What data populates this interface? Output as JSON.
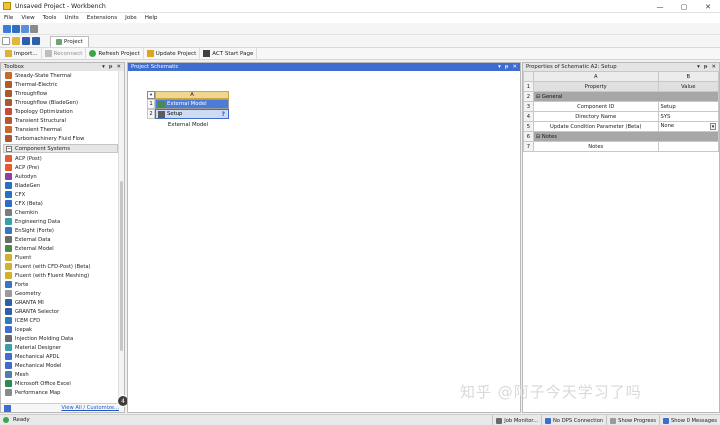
{
  "window": {
    "title": "Unsaved Project - Workbench",
    "controls": [
      "—",
      "▢",
      "✕"
    ]
  },
  "menu": [
    "File",
    "View",
    "Tools",
    "Units",
    "Extensions",
    "Jobs",
    "Help"
  ],
  "project_tab": {
    "label": "Project"
  },
  "toolbar": {
    "import": "Import...",
    "reconnect": "Reconnect",
    "refresh": "Refresh Project",
    "update": "Update Project",
    "act_start": "ACT Start Page"
  },
  "toolbox": {
    "title": "Toolbox",
    "header_buttons": [
      "▾",
      "ᵽ",
      "✕"
    ],
    "analysis_items": [
      {
        "label": "Steady-State Thermal",
        "color": "#c66a2b"
      },
      {
        "label": "Thermal-Electric",
        "color": "#b45a2a"
      },
      {
        "label": "Throughflow",
        "color": "#a65a2e"
      },
      {
        "label": "Throughflow (BladeGen)",
        "color": "#a65a2e"
      },
      {
        "label": "Topology Optimization",
        "color": "#c94a36"
      },
      {
        "label": "Transient Structural",
        "color": "#b35b2e"
      },
      {
        "label": "Transient Thermal",
        "color": "#c96a2a"
      },
      {
        "label": "Turbomachinery Fluid Flow",
        "color": "#a55a2f"
      }
    ],
    "group_label": "Component Systems",
    "component_items": [
      {
        "label": "ACP (Post)",
        "color": "#e8592e"
      },
      {
        "label": "ACP (Pre)",
        "color": "#e8592e"
      },
      {
        "label": "Autodyn",
        "color": "#8f3fa1"
      },
      {
        "label": "BladeGen",
        "color": "#2f6ebd"
      },
      {
        "label": "CFX",
        "color": "#2d6fc7"
      },
      {
        "label": "CFX (Beta)",
        "color": "#2d6fc7"
      },
      {
        "label": "Chemkin",
        "color": "#7c7c7c"
      },
      {
        "label": "Engineering Data",
        "color": "#3aa0a8"
      },
      {
        "label": "EnSight (Forte)",
        "color": "#3c74c4"
      },
      {
        "label": "External Data",
        "color": "#6b6b6b"
      },
      {
        "label": "External Model",
        "color": "#4c8a4c"
      },
      {
        "label": "Fluent",
        "color": "#d4b12b"
      },
      {
        "label": "Fluent (with CFD-Post) (Beta)",
        "color": "#d4b12b"
      },
      {
        "label": "Fluent (with Fluent Meshing)",
        "color": "#d4b12b"
      },
      {
        "label": "Forte",
        "color": "#3c74c4"
      },
      {
        "label": "Geometry",
        "color": "#9b9b9b"
      },
      {
        "label": "GRANTA MI",
        "color": "#2f5fa8"
      },
      {
        "label": "GRANTA Selector",
        "color": "#2f5fa8"
      },
      {
        "label": "ICEM CFD",
        "color": "#2e7cc0"
      },
      {
        "label": "Icepak",
        "color": "#3f6ccf"
      },
      {
        "label": "Injection Molding Data",
        "color": "#6a6a6a"
      },
      {
        "label": "Material Designer",
        "color": "#3aa0a8"
      },
      {
        "label": "Mechanical APDL",
        "color": "#3f6ccf"
      },
      {
        "label": "Mechanical Model",
        "color": "#3f6ccf"
      },
      {
        "label": "Mesh",
        "color": "#4f7ea8"
      },
      {
        "label": "Microsoft Office Excel",
        "color": "#2e8b4f"
      },
      {
        "label": "Performance Map",
        "color": "#8a8a8a"
      }
    ],
    "footer_link": "View All / Customize...",
    "badge": "4"
  },
  "schematic": {
    "title": "Project Schematic",
    "system": {
      "column": "A",
      "rows": [
        {
          "num": "1",
          "label": "External Model",
          "icon_color": "#4c8a4c"
        },
        {
          "num": "2",
          "label": "Setup",
          "icon_color": "#5c5c5c",
          "status": "?"
        }
      ],
      "caption": "External Model"
    }
  },
  "properties": {
    "title": "Properties of Schematic A2: Setup",
    "columns": [
      "A",
      "B"
    ],
    "header": {
      "num": "1",
      "a": "Property",
      "b": "Value"
    },
    "rows": [
      {
        "num": "2",
        "group": true,
        "a": "General"
      },
      {
        "num": "3",
        "a": "Component ID",
        "b": "Setup"
      },
      {
        "num": "4",
        "a": "Directory Name",
        "b": "SYS"
      },
      {
        "num": "5",
        "a": "Update Condition Parameter (Beta)",
        "b": "None"
      },
      {
        "num": "6",
        "group": true,
        "a": "Notes"
      },
      {
        "num": "7",
        "a": "Notes",
        "b": ""
      }
    ]
  },
  "status": {
    "text": "Ready",
    "buttons": [
      "Job Monitor...",
      "No DPS Connection",
      "Show Progress",
      "Show 0 Messages"
    ]
  },
  "watermark": "知乎 @阿子今天学习了吗",
  "colors": {
    "accent_blue": "#3f6ccf",
    "system_header": "#f1d78d",
    "selected_row": "#4d7cd8"
  }
}
